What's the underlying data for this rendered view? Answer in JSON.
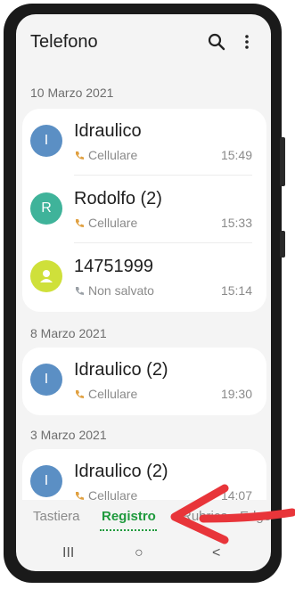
{
  "app": {
    "title": "Telefono"
  },
  "header": {
    "search_icon": "search-icon",
    "menu_icon": "more-vertical-icon"
  },
  "sections": [
    {
      "date": "10 Marzo 2021",
      "calls": [
        {
          "initial": "I",
          "name": "Idraulico",
          "type": "Cellulare",
          "time": "15:49",
          "avatar_color": "#5b8fc4"
        },
        {
          "initial": "R",
          "name": "Rodolfo (2)",
          "type": "Cellulare",
          "time": "15:33",
          "avatar_color": "#3fb39a"
        },
        {
          "initial": "",
          "name": "14751999",
          "type": "Non salvato",
          "time": "15:14",
          "avatar_color": "#cfe03a"
        }
      ]
    },
    {
      "date": "8 Marzo 2021",
      "calls": [
        {
          "initial": "I",
          "name": "Idraulico (2)",
          "type": "Cellulare",
          "time": "19:30",
          "avatar_color": "#5b8fc4"
        }
      ]
    },
    {
      "date": "3 Marzo 2021",
      "calls": [
        {
          "initial": "I",
          "name": "Idraulico (2)",
          "type": "Cellulare",
          "time": "14:07",
          "avatar_color": "#5b8fc4"
        }
      ]
    }
  ],
  "tabs": [
    {
      "label": "Tastiera",
      "active": false
    },
    {
      "label": "Registro",
      "active": true
    },
    {
      "label": "Rubrica",
      "active": false
    },
    {
      "label": "Edge",
      "active": false
    }
  ],
  "nav": {
    "recents": "III",
    "home": "○",
    "back": "<"
  },
  "colors": {
    "accent": "#1f9a3d",
    "annotation_arrow": "#e8353a"
  }
}
